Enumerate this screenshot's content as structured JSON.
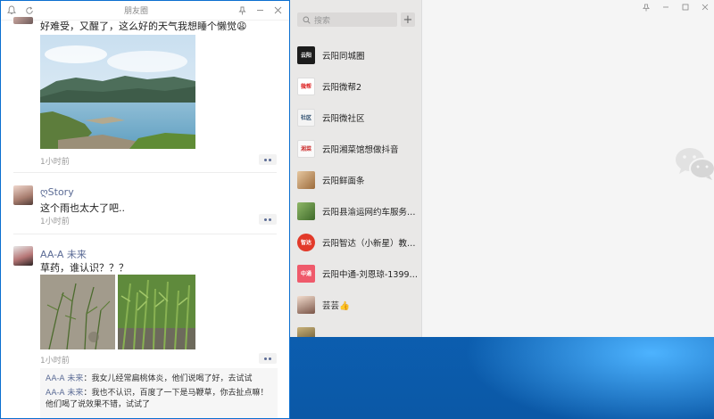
{
  "moments": {
    "title": "朋友圈",
    "posts": [
      {
        "text": "好难受，又醒了，这么好的天气我想睡个懒觉😩",
        "time": "1小时前"
      },
      {
        "name": "ღStory",
        "text": "这个雨也太大了吧..",
        "time": "1小时前"
      },
      {
        "name": "AA-A 未来",
        "text": "草药，谁认识？？？",
        "time": "1小时前"
      }
    ],
    "comments": [
      {
        "name": "AA-A 未来",
        "text": "：我女儿经常扁桃体炎，他们说喝了好，去试试"
      },
      {
        "name": "AA-A 未来",
        "text": "：我也不认识，百度了一下是马鞭草，你去扯点嘛！他们喝了说效果不错，试试了"
      }
    ]
  },
  "chat": {
    "search_placeholder": "搜索",
    "add_label": "+",
    "items": [
      {
        "name": "云阳同城圈",
        "avatar_text": "云阳"
      },
      {
        "name": "云阳微帮2",
        "avatar_text": "微帮"
      },
      {
        "name": "云阳微社区",
        "avatar_text": "社区"
      },
      {
        "name": "云阳湘菜馆想做抖音",
        "avatar_text": "湘菜"
      },
      {
        "name": "云阳鲜面条",
        "avatar_text": ""
      },
      {
        "name": "云阳县渝运网约车服务中心",
        "avatar_text": ""
      },
      {
        "name": "云阳智达（小新星）教育D...",
        "avatar_text": "智达"
      },
      {
        "name": "云阳中通-刘恩琼-1399655...",
        "avatar_text": "中通"
      },
      {
        "name": "芸芸👍",
        "avatar_text": ""
      }
    ],
    "window_controls": [
      "pin-icon",
      "minimize-icon",
      "maximize-icon",
      "close-icon"
    ]
  },
  "colors": {
    "accent": "#5b6b95",
    "desktop": "#1583d6"
  }
}
